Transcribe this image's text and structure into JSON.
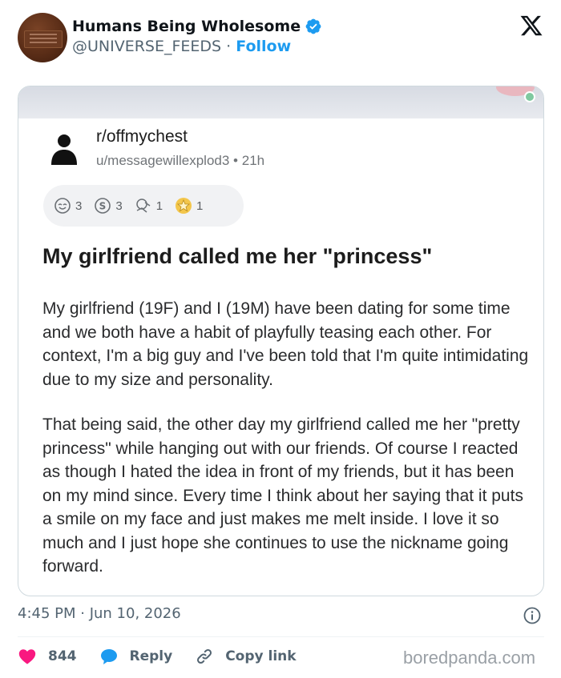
{
  "tweet": {
    "display_name": "Humans Being Wholesome",
    "handle": "@UNIVERSE_FEEDS",
    "separator": " · ",
    "follow_label": "Follow",
    "timestamp": "4:45 PM · Jun 10, 2026",
    "likes": "844",
    "reply_label": "Reply",
    "copy_link_label": "Copy link"
  },
  "reddit_post": {
    "subreddit": "r/offmychest",
    "user": "u/messagewillexplod3",
    "age": "21h",
    "awards": [
      {
        "icon": "wholesome-award-icon",
        "count": "3"
      },
      {
        "icon": "silver-award-icon",
        "count": "3"
      },
      {
        "icon": "hug-award-icon",
        "count": "1"
      },
      {
        "icon": "gold-award-icon",
        "count": "1"
      }
    ],
    "title": "My girlfriend called me her \"princess\"",
    "paragraph_1": "My girlfriend (19F) and I (19M) have been dating for some time and we both have a habit of playfully teasing each other. For context, I'm a big guy and I've been told that I'm quite intimidating due to my size and personality.",
    "paragraph_2": "That being said, the other day my girlfriend called me her \"pretty princess\" while hanging out with our friends. Of course I reacted as though I hated the idea in front of my friends, but it has been on my mind since. Every time I think about her saying that it puts a smile on my face and just makes me melt inside. I love it so much and I just hope she continues to use the nickname going forward."
  },
  "watermark": "boredpanda.com",
  "colors": {
    "accent": "#1d9bf0",
    "like": "#f91880",
    "muted": "#536471"
  }
}
